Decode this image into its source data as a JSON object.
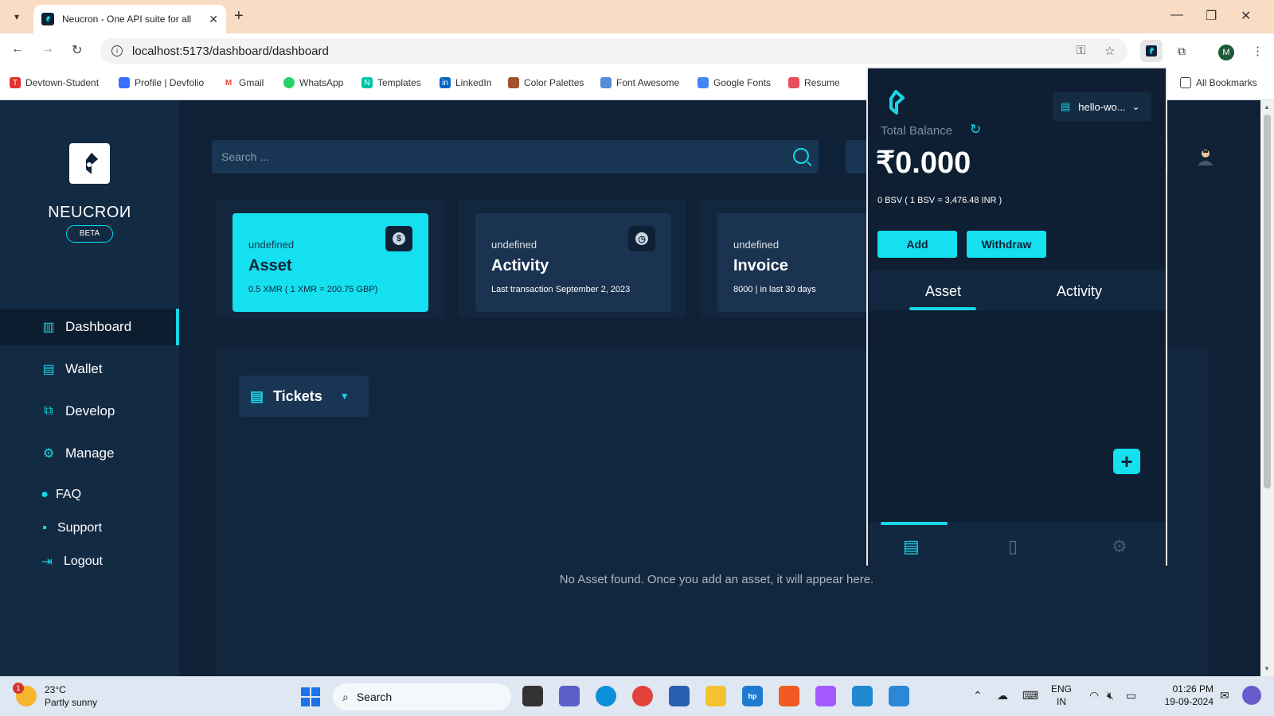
{
  "browser": {
    "tab_title": "Neucron - One API suite for all",
    "url": "localhost:5173/dashboard/dashboard",
    "profile_initial": "M",
    "bookmarks": [
      {
        "label": "Devtown-Student",
        "icon": "devtown-icon",
        "color": "#e0332b"
      },
      {
        "label": "Profile | Devfolio",
        "icon": "devfolio-icon",
        "color": "#3770ff"
      },
      {
        "label": "Gmail",
        "icon": "gmail-icon",
        "color": "#ea4335"
      },
      {
        "label": "WhatsApp",
        "icon": "whatsapp-icon",
        "color": "#25d366"
      },
      {
        "label": "Templates",
        "icon": "templates-icon",
        "color": "#00c2a8"
      },
      {
        "label": "LinkedIn",
        "icon": "linkedin-icon",
        "color": "#0a66c2"
      },
      {
        "label": "Color Palettes",
        "icon": "palette-icon",
        "color": "#a0522d"
      },
      {
        "label": "Font Awesome",
        "icon": "fontawesome-icon",
        "color": "#538dd7"
      },
      {
        "label": "Google Fonts",
        "icon": "googlefonts-icon",
        "color": "#4285f4"
      },
      {
        "label": "Resume",
        "icon": "resume-icon",
        "color": "#e84c5b"
      }
    ],
    "all_bookmarks": "All Bookmarks"
  },
  "sidebar": {
    "brand": "NEUCROИ",
    "beta": "BETA",
    "items": [
      {
        "label": "Dashboard",
        "icon": "dashboard-icon"
      },
      {
        "label": "Wallet",
        "icon": "wallet-icon"
      },
      {
        "label": "Develop",
        "icon": "develop-icon"
      },
      {
        "label": "Manage",
        "icon": "manage-icon"
      },
      {
        "label": "FAQ",
        "icon": "faq-icon"
      },
      {
        "label": "Support",
        "icon": "support-icon"
      },
      {
        "label": "Logout",
        "icon": "logout-icon"
      }
    ]
  },
  "main": {
    "search_placeholder": "Search ...",
    "cards": [
      {
        "sub": "undefined",
        "title": "Asset",
        "meta": "0.5 XMR ( 1 XMR = 200.75 GBP)"
      },
      {
        "sub": "undefined",
        "title": "Activity",
        "meta": "Last transaction September 2, 2023"
      },
      {
        "sub": "undefined",
        "title": "Invoice",
        "meta": "8000 | in last 30 days"
      }
    ],
    "tickets_label": "Tickets",
    "empty_message": "No Asset found. Once you add an asset, it will appear here."
  },
  "popup": {
    "account": "hello-wo...",
    "total_balance_label": "Total Balance",
    "balance": "₹0.000",
    "rate": "0 BSV ( 1 BSV = 3,476.48 INR )",
    "add_label": "Add",
    "withdraw_label": "Withdraw",
    "tabs": [
      "Asset",
      "Activity"
    ],
    "active_tab": "Asset"
  },
  "taskbar": {
    "weather_temp": "23°C",
    "weather_desc": "Partly sunny",
    "weather_badge": "1",
    "search_label": "Search",
    "lang_line1": "ENG",
    "lang_line2": "IN",
    "time": "01:26 PM",
    "date": "19-09-2024"
  },
  "colors": {
    "accent": "#14e0f0",
    "background": "#0f2136",
    "sidebar": "#132a43"
  }
}
